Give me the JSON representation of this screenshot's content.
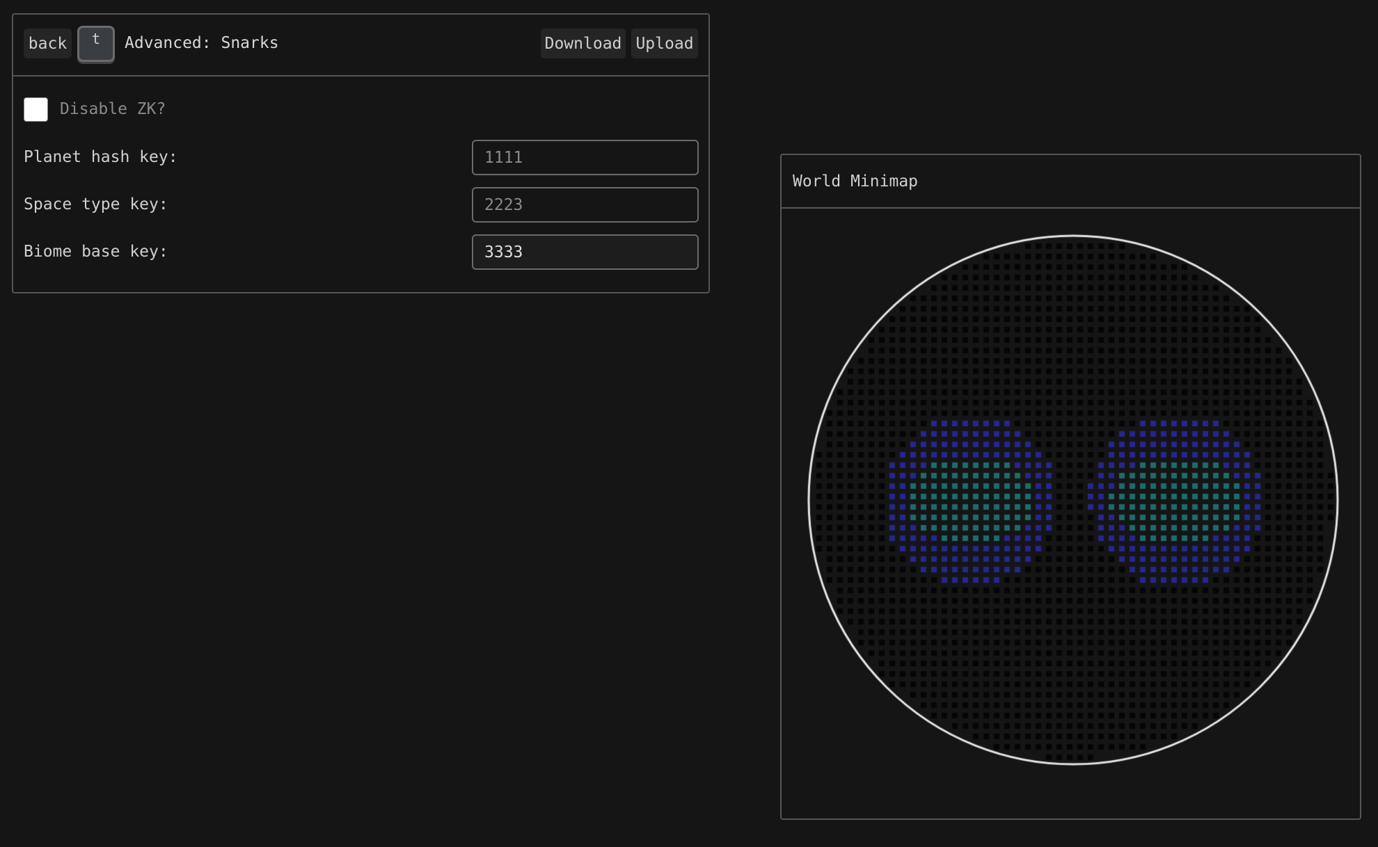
{
  "snarks_panel": {
    "back_label": "back",
    "hotkey_label": "t",
    "title": "Advanced: Snarks",
    "download_label": "Download",
    "upload_label": "Upload",
    "disable_zk": {
      "label": "Disable ZK?",
      "checked": false
    },
    "fields": [
      {
        "label": "Planet hash key:",
        "value": "1111"
      },
      {
        "label": "Space type key:",
        "value": "2223"
      },
      {
        "label": "Biome base key:",
        "value": "3333"
      }
    ]
  },
  "minimap": {
    "title": "World Minimap",
    "colors": {
      "border": "#e6e6e6",
      "space": "#050505",
      "blue_biome": "#26268f",
      "teal_biome": "#1e6b6b"
    }
  }
}
